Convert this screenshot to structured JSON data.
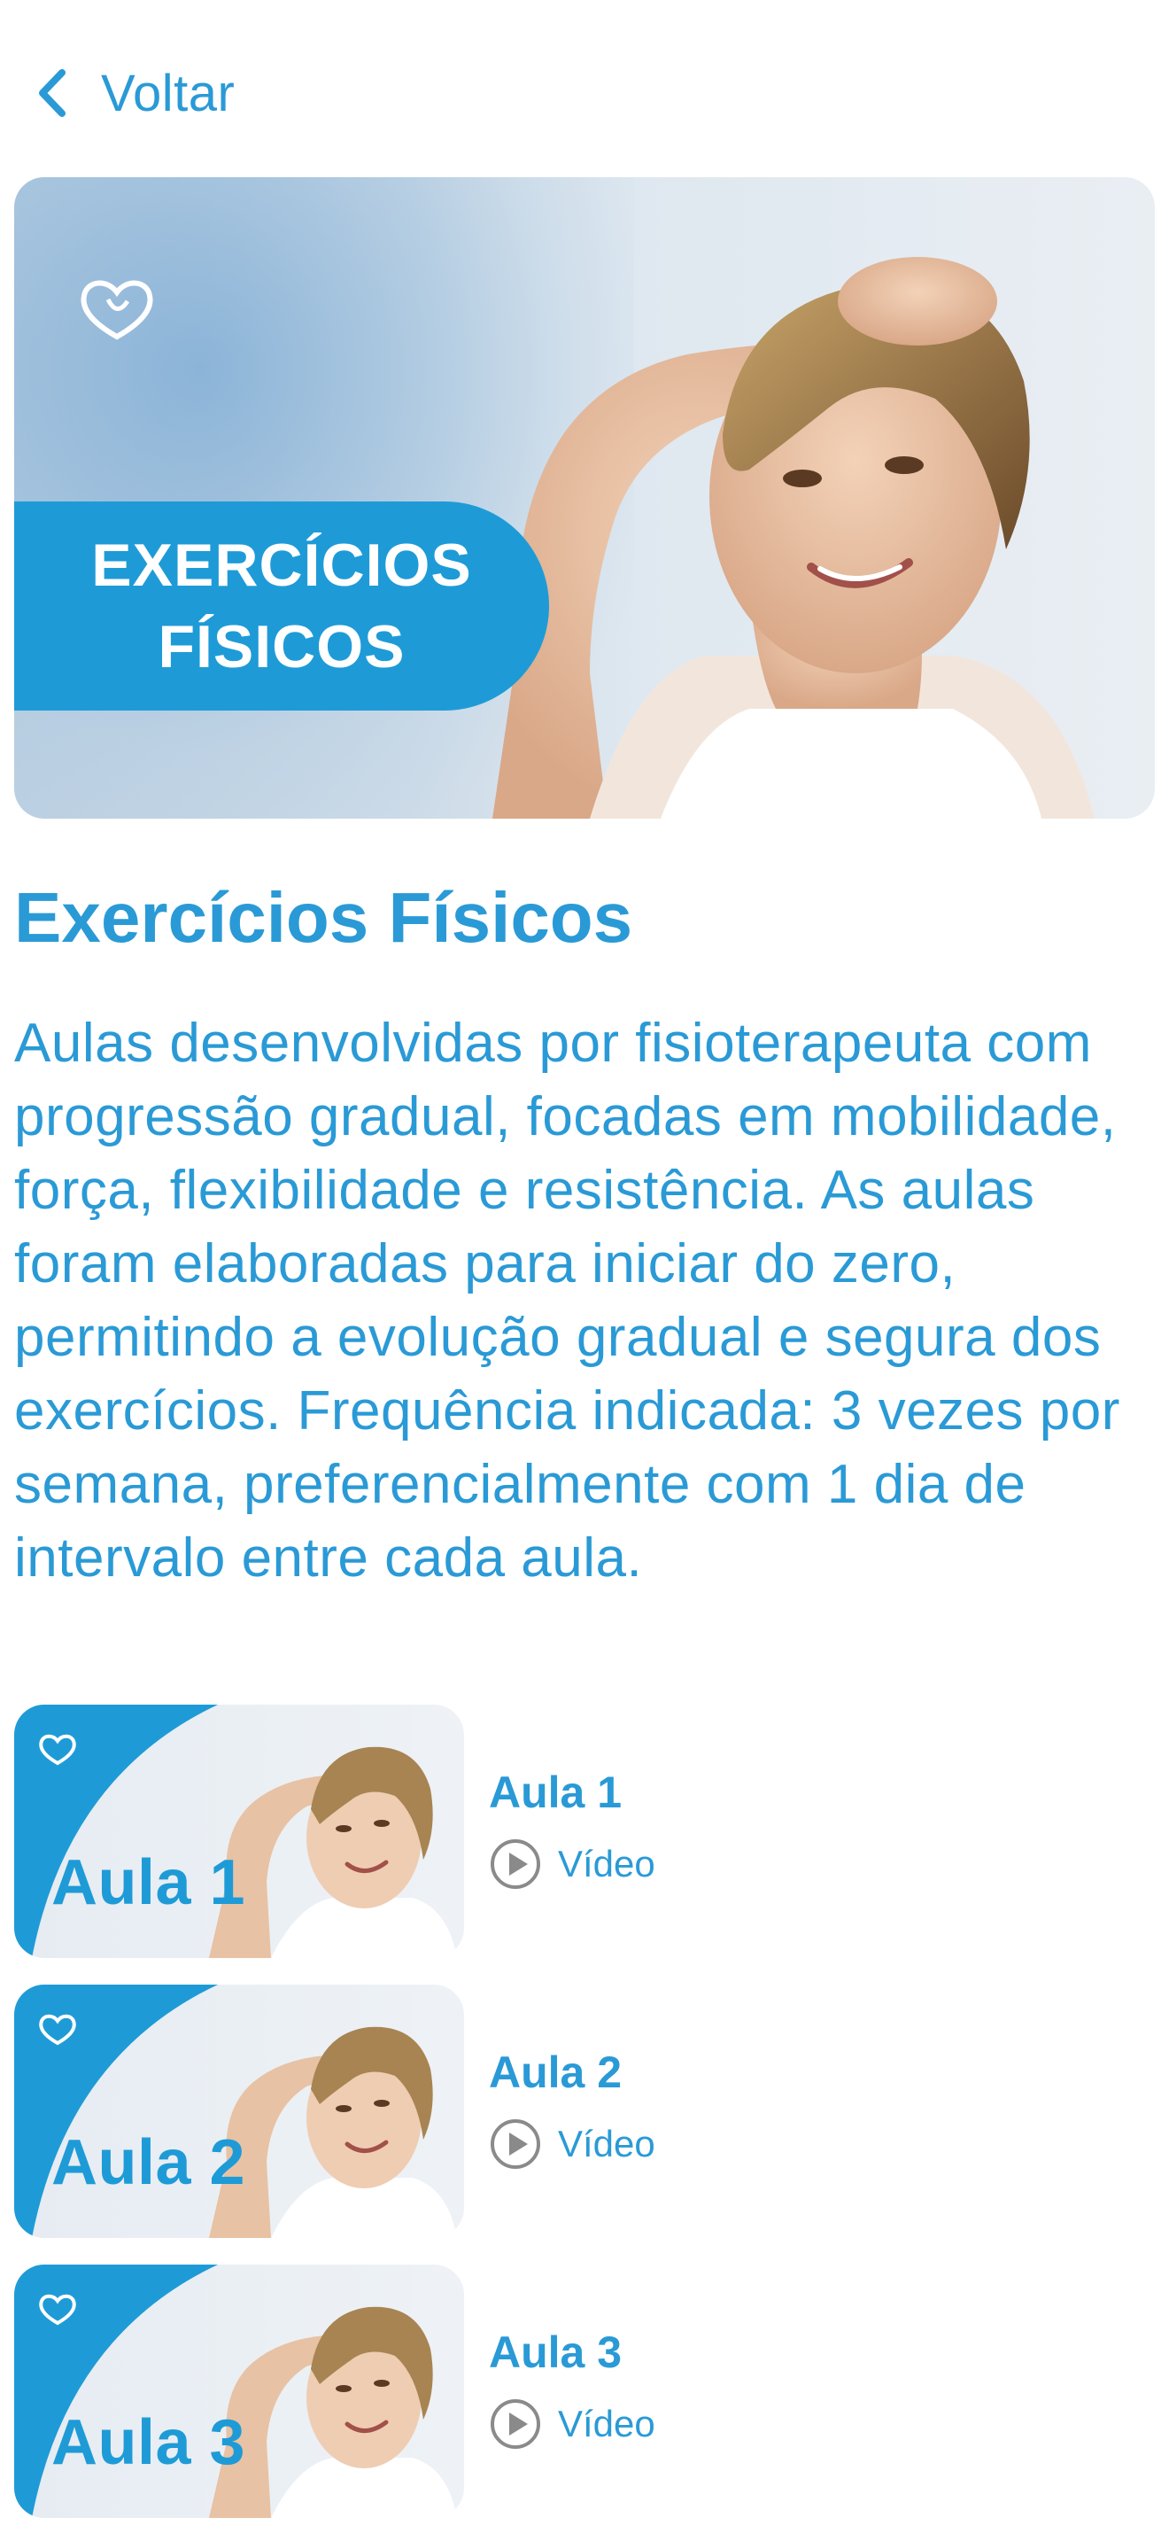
{
  "nav": {
    "back_label": "Voltar"
  },
  "hero": {
    "banner_line1": "EXERCÍCIOS",
    "banner_line2": "FÍSICOS"
  },
  "course": {
    "title": "Exercícios Físicos",
    "description": "Aulas desenvolvidas por fisioterapeuta com progressão gradual, focadas em mobilidade, força, flexibilidade e resistência. As aulas foram elaboradas para iniciar do zero, permitindo a evolução gradual e segura dos exercícios. Frequência indicada: 3 vezes por semana, preferencialmente com 1 dia de intervalo entre cada aula."
  },
  "lessons": [
    {
      "thumb_label": "Aula 1",
      "name": "Aula 1",
      "type_label": "Vídeo",
      "icon": "play-circle-icon"
    },
    {
      "thumb_label": "Aula 2",
      "name": "Aula 2",
      "type_label": "Vídeo",
      "icon": "play-circle-icon"
    },
    {
      "thumb_label": "Aula 3",
      "name": "Aula 3",
      "type_label": "Vídeo",
      "icon": "play-circle-icon"
    }
  ],
  "colors": {
    "accent": "#2a9ad6",
    "banner": "#1e9bd7",
    "icon_gray": "#8a8a8a"
  }
}
